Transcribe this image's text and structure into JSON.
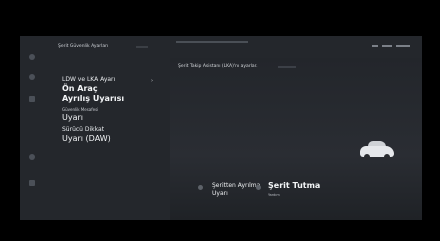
{
  "header": {
    "title": "Şerit Güvenlik Ayarları"
  },
  "menu": {
    "items": [
      {
        "label": "LDW ve LKA Ayarı",
        "value_line1": "Ön Araç",
        "value_line2": "Ayrılış Uyarısı"
      },
      {
        "label": "Güvenlik Mesafesi",
        "value": "Uyarı"
      },
      {
        "label": "Sürücü Dikkat",
        "value": "Uyarı (DAW)"
      }
    ]
  },
  "content": {
    "title": "Şerit Takip Asistanı (LKA)'nı ayarlar.",
    "options": [
      {
        "line1": "Şeritten Ayrılma",
        "line2": "Uyarı"
      },
      {
        "label": "Şerit Tutma",
        "sub": "Yardım"
      }
    ]
  }
}
